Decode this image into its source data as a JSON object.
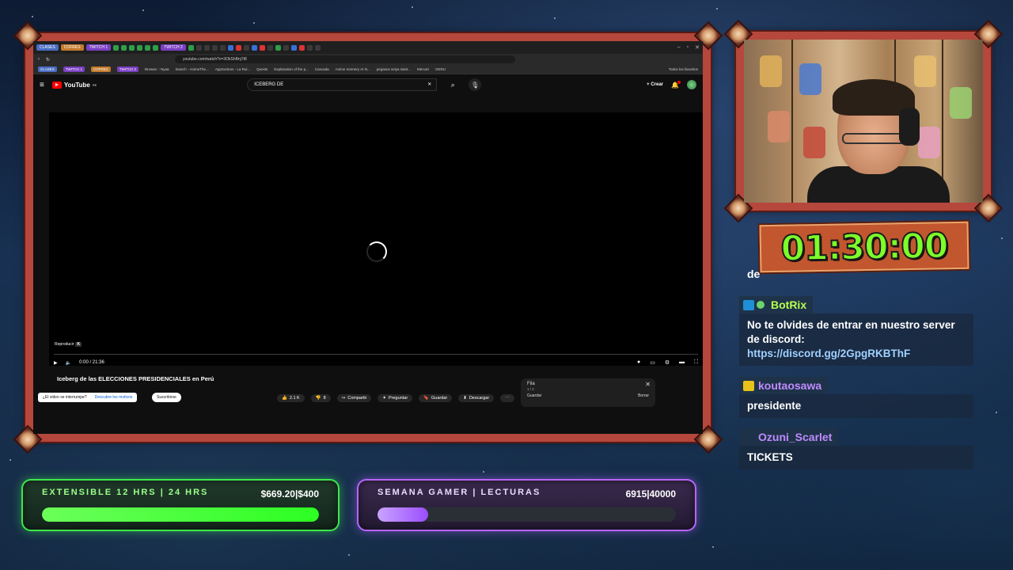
{
  "browser": {
    "tab_pills": [
      {
        "label": "CLASES",
        "color": "#4a6cc2"
      },
      {
        "label": "COFRES",
        "color": "#c27a2c"
      },
      {
        "label": "TWITCH 1",
        "color": "#7a3fc2"
      },
      {
        "label": "TWITCH 2",
        "color": "#7a3fc2"
      }
    ],
    "url": "youtube.com/watch?v=3OkShBnj7t8",
    "bookmarks": [
      "CLASES",
      "TWITCH 1",
      "COFRES",
      "TWITCH 2",
      "Browse :: Nyaa",
      "Search - AnimeThe...",
      "AppSorteos - La Rul...",
      "Quests",
      "Explanation of the p...",
      "Cascada",
      "Anime Scenery At N...",
      "pegasus seiya saint...",
      "Mercari",
      "OKRU",
      "Todos los favoritos"
    ]
  },
  "youtube": {
    "logo_text": "YouTube",
    "logo_suffix": "PE",
    "search_value": "ICEBERG DE",
    "create_label": "Crear",
    "play_hint": "Reproducir",
    "play_hint_key": "K",
    "time": "0:00 / 21:36",
    "video_title": "Iceberg de las ELECCIONES PRESIDENCIALES en Perú",
    "tooltip_text": "¿El video se interrumpe?",
    "tooltip_link": "Descubre los motivos",
    "subscribe_label": "Suscribirse",
    "like_count": "2.1 K",
    "dislike_count": "8",
    "share_label": "Compartir",
    "ask_label": "Preguntar",
    "save_label": "Guardar",
    "download_label": "Descargar",
    "queue": {
      "title": "Fila",
      "sub": "1 / 2",
      "save": "Guardar",
      "clear": "Borrar"
    }
  },
  "timer": "01:30:00",
  "chat": {
    "partial_line": "de",
    "messages": [
      {
        "user": "BotRix",
        "color": "#b6ff4d",
        "text": "No te olvides de entrar en nuestro server de discord:",
        "link": "https://discord.gg/2GpgRKBThF"
      },
      {
        "user": "koutaosawa",
        "color": "#c08bff",
        "text": "presidente"
      },
      {
        "user": "Ozuni_Scarlet",
        "color": "#c08bff",
        "text": "TICKETS"
      }
    ]
  },
  "goals": [
    {
      "label": "EXTENSIBLE 12 HRS | 24 HRS",
      "amount": "$669.20|$400",
      "progress": 1.0,
      "color": "#3ee74c"
    },
    {
      "label": "SEMANA GAMER | LECTURAS",
      "amount": "6915|40000",
      "progress": 0.17,
      "color": "#b665ff"
    }
  ]
}
